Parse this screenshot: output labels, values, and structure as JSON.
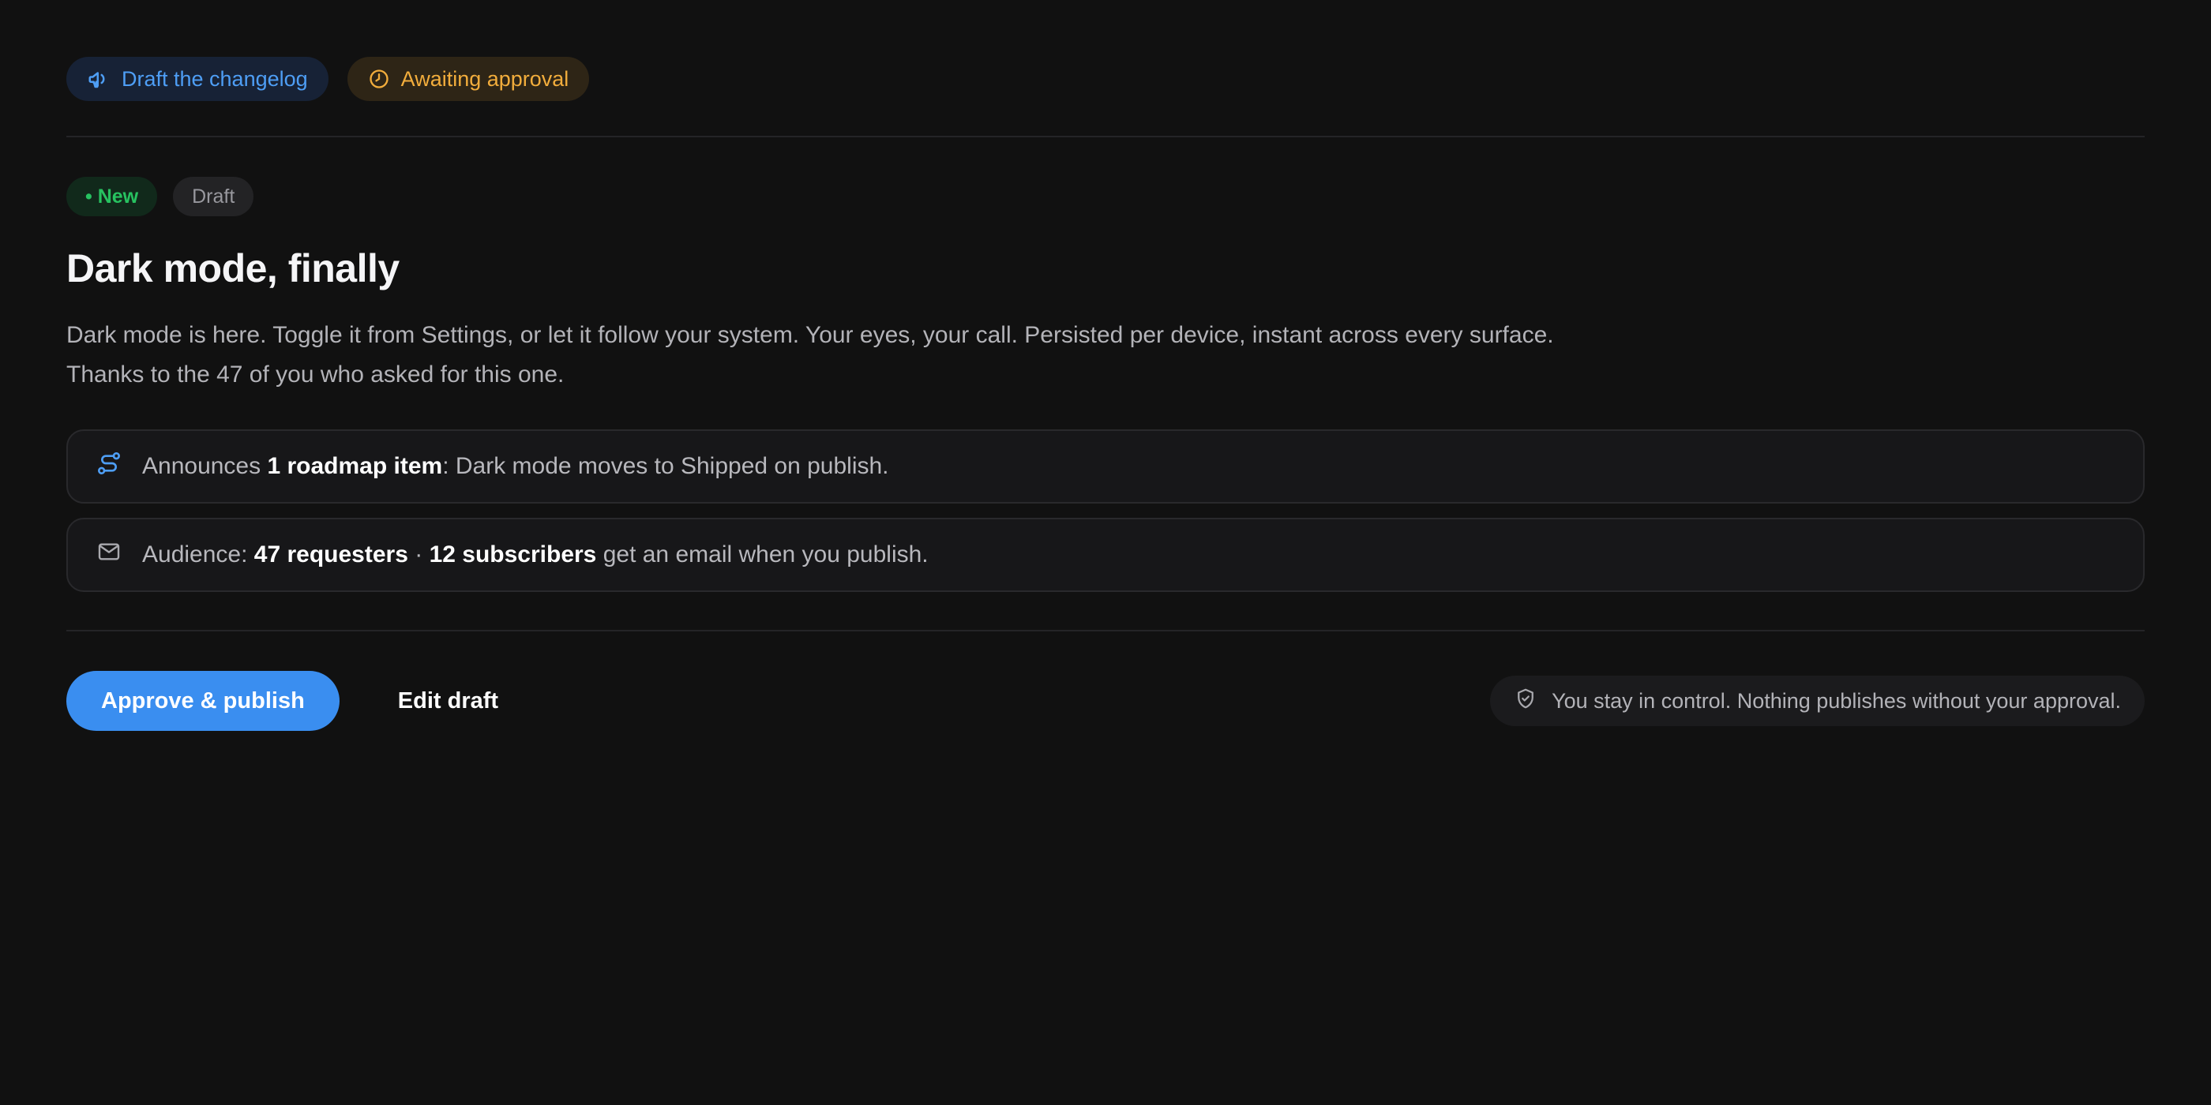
{
  "header": {
    "task_label": "Draft the changelog",
    "task_icon": "megaphone-icon",
    "status_label": "Awaiting approval",
    "status_icon": "clock-icon"
  },
  "entry": {
    "tags": {
      "new": "• New",
      "draft": "Draft"
    },
    "title": "Dark mode, finally",
    "body": "Dark mode is here. Toggle it from Settings, or let it follow your system. Your eyes, your call. Persisted per device, instant across every surface. Thanks to the 47 of you who asked for this one."
  },
  "roadmap_card": {
    "icon": "route-icon",
    "prefix": "Announces ",
    "highlight": "1 roadmap item",
    "suffix": ": Dark mode moves to Shipped on publish."
  },
  "audience_card": {
    "icon": "mail-icon",
    "prefix": "Audience: ",
    "requesters": "47 requesters",
    "separator": " · ",
    "subscribers": "12 subscribers",
    "suffix": " get an email when you publish."
  },
  "actions": {
    "approve_label": "Approve & publish",
    "edit_label": "Edit draft",
    "control_note": "You stay in control. Nothing publishes without your approval.",
    "control_icon": "shield-check-icon"
  },
  "colors": {
    "background": "#111111",
    "accent": "#3a8ef0",
    "new_green": "#27c260",
    "awaiting_amber": "#f2ad3c"
  }
}
